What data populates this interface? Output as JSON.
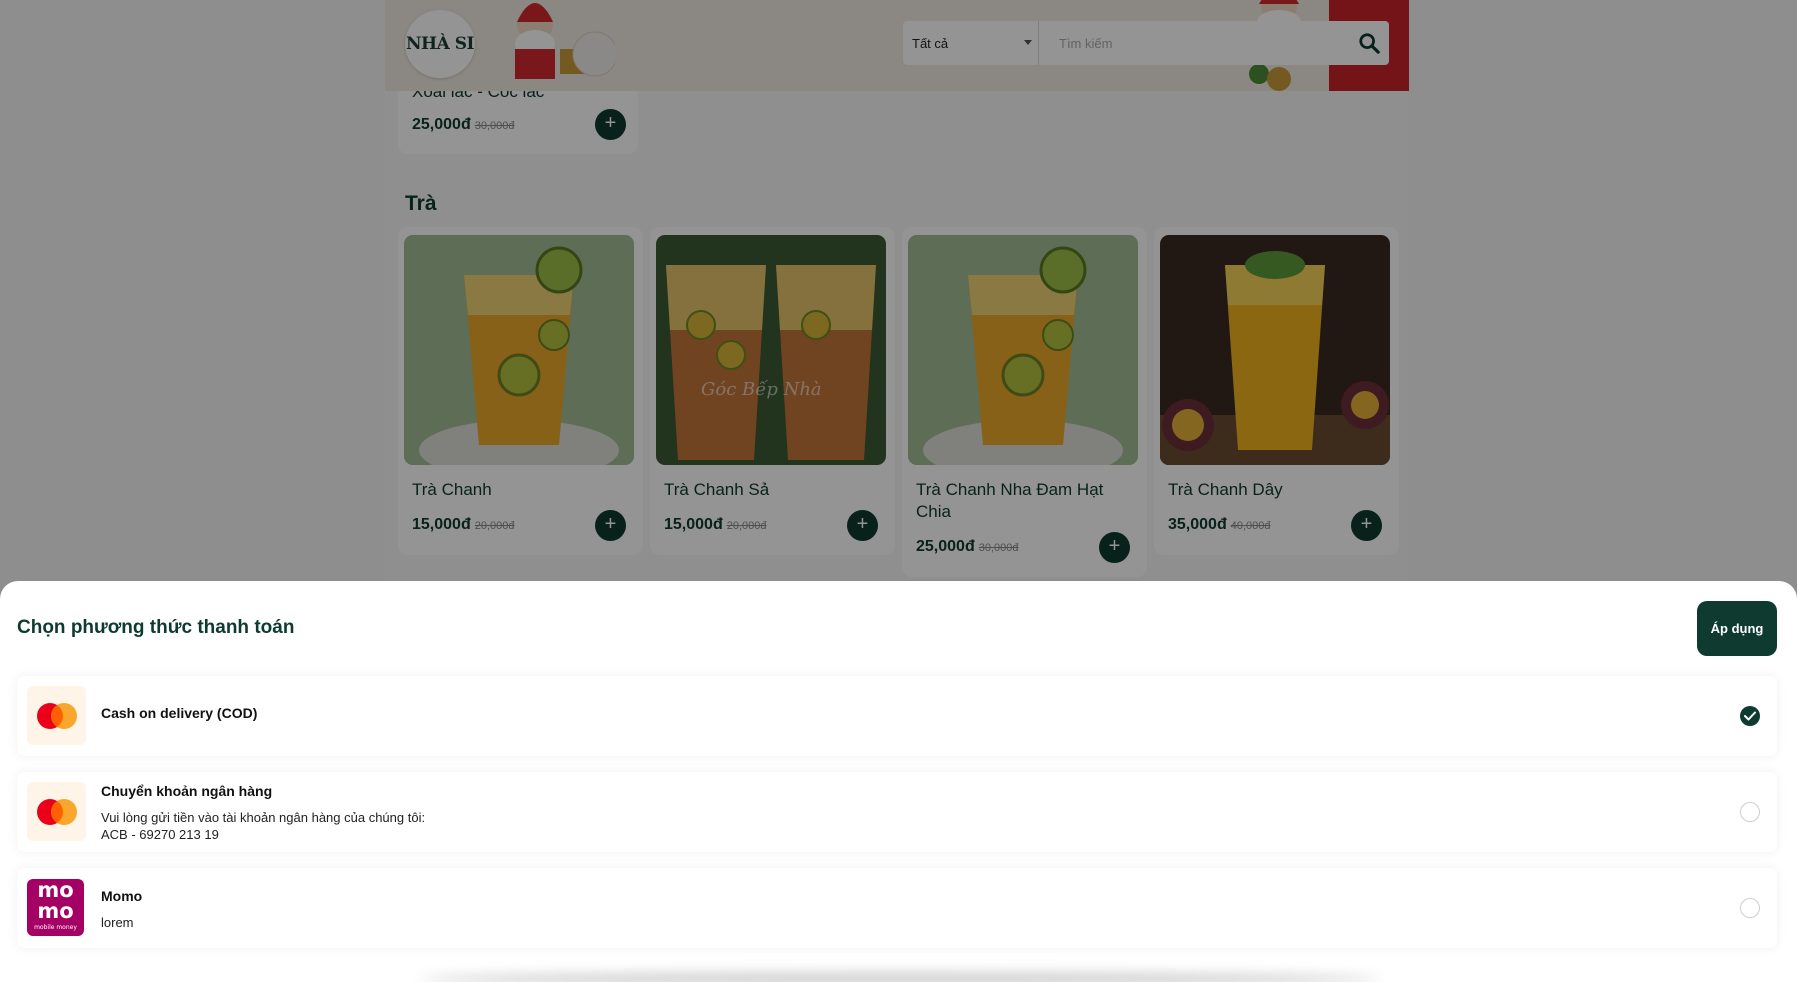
{
  "header": {
    "logo_text": "NHÀ SI",
    "search": {
      "category_selected": "Tất cả",
      "placeholder": "Tìm kiếm"
    }
  },
  "previous_item": {
    "name": "Xoài lắc - Cóc lắc",
    "price": "25,000đ",
    "old_price": "30,000đ"
  },
  "section": {
    "title": "Trà",
    "products": [
      {
        "name": "Trà Chanh",
        "price": "15,000đ",
        "old_price": "20,000đ"
      },
      {
        "name": "Trà Chanh Sả",
        "price": "15,000đ",
        "old_price": "20,000đ",
        "watermark": "Góc Bếp Nhà"
      },
      {
        "name": "Trà Chanh Nha Đam Hạt Chia",
        "price": "25,000đ",
        "old_price": "30,000đ"
      },
      {
        "name": "Trà Chanh Dây",
        "price": "35,000đ",
        "old_price": "40,000đ"
      }
    ]
  },
  "payment_sheet": {
    "title": "Chọn phương thức thanh toán",
    "apply_label": "Áp dụng",
    "methods": [
      {
        "name": "Cash on delivery (COD)",
        "icon": "mastercard-icon",
        "selected": true
      },
      {
        "name": "Chuyển khoản ngân hàng",
        "desc_line1": "Vui lòng gửi tiền vào tài khoản ngân hàng của chúng tôi:",
        "desc_line2": "ACB - 69270 213 19",
        "icon": "mastercard-icon",
        "selected": false
      },
      {
        "name": "Momo",
        "desc_line1": "lorem",
        "icon": "momo-icon",
        "logo_top": "mo",
        "logo_bottom": "mo",
        "logo_caption": "mobile money",
        "selected": false
      }
    ]
  },
  "colors": {
    "brand_dark_green": "#0e3a2f",
    "overlay": "rgba(0,0,0,0.42)"
  }
}
